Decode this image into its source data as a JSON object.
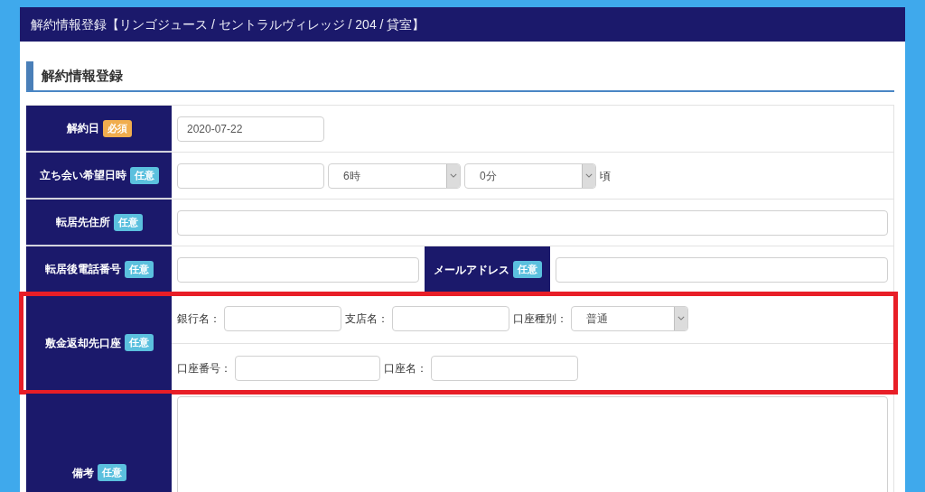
{
  "window": {
    "title": "解約情報登録【リンゴジュース / セントラルヴィレッジ / 204 / 貸室】"
  },
  "section": {
    "heading": "解約情報登録"
  },
  "form": {
    "rows": [
      {
        "label": "解約日",
        "badge": {
          "text": "必須",
          "kind": "required"
        },
        "highlighted": false,
        "lines": [
          [
            {
              "kind": "input",
              "value": "2020-07-22"
            }
          ]
        ]
      },
      {
        "label": "立ち会い希望日時",
        "badge": {
          "text": "任意",
          "kind": "optional"
        },
        "highlighted": false,
        "lines": [
          [
            {
              "kind": "input"
            },
            {
              "kind": "select",
              "value": "6時"
            },
            {
              "kind": "select",
              "value": "0分"
            },
            {
              "kind": "text",
              "text": "頃"
            }
          ]
        ]
      },
      {
        "label": "転居先住所",
        "badge": {
          "text": "任意",
          "kind": "optional"
        },
        "highlighted": false,
        "lines": [
          [
            {
              "kind": "input"
            }
          ]
        ]
      },
      {
        "label": "転居後電話番号",
        "badge": {
          "text": "任意",
          "kind": "optional"
        },
        "highlighted": false,
        "lines": [
          [
            {
              "kind": "input"
            },
            {
              "kind": "header",
              "label": "メールアドレス",
              "badge": {
                "text": "任意",
                "kind": "optional"
              }
            },
            {
              "kind": "input"
            }
          ]
        ]
      },
      {
        "label": "敷金返却先口座",
        "badge": {
          "text": "任意",
          "kind": "optional"
        },
        "highlighted": true,
        "lines": [
          [
            {
              "kind": "text",
              "text": "銀行名："
            },
            {
              "kind": "input"
            },
            {
              "kind": "text",
              "text": "支店名："
            },
            {
              "kind": "input"
            },
            {
              "kind": "text",
              "text": "口座種別："
            },
            {
              "kind": "select",
              "value": "普通"
            }
          ],
          [
            {
              "kind": "text",
              "text": "口座番号："
            },
            {
              "kind": "input"
            },
            {
              "kind": "text",
              "text": "口座名："
            },
            {
              "kind": "input"
            }
          ]
        ]
      },
      {
        "label": "備考",
        "badge": {
          "text": "任意",
          "kind": "optional"
        },
        "highlighted": false,
        "lines": [
          [
            {
              "kind": "textarea"
            }
          ]
        ]
      }
    ]
  }
}
